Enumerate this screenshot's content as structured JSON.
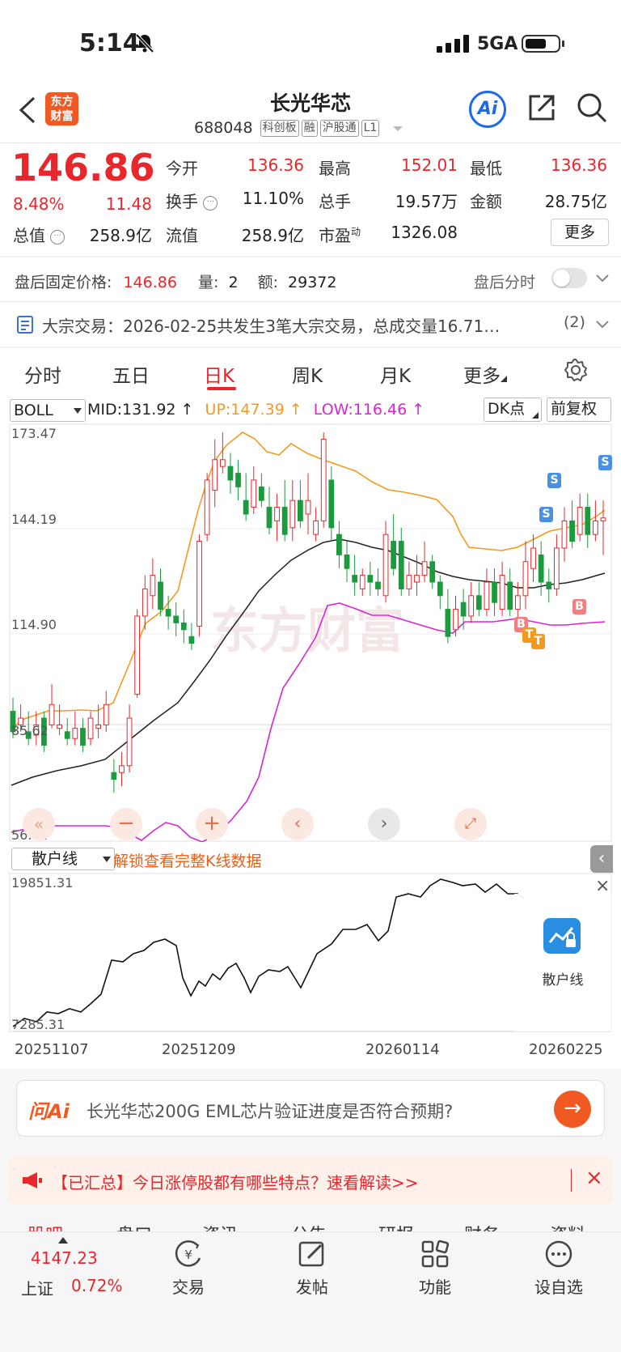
{
  "status_bar": {
    "time": "5:14",
    "network": "5GA"
  },
  "header": {
    "logo_text": "东方\n财富",
    "title": "长光华芯",
    "code": "688048",
    "tags": [
      "科创板",
      "融",
      "沪股通",
      "L1"
    ],
    "ai_label": "Ai"
  },
  "quote": {
    "price": "146.86",
    "change_pct": "8.48%",
    "change": "11.48",
    "open_label": "今开",
    "open": "136.36",
    "high_label": "最高",
    "high": "152.01",
    "low_label": "最低",
    "low": "136.36",
    "turnover_label": "换手",
    "turnover": "11.10%",
    "volume_label": "总手",
    "volume": "19.57万",
    "amount_label": "金额",
    "amount": "28.75亿",
    "mktcap_label": "总值",
    "mktcap": "258.9亿",
    "float_label": "流值",
    "float": "258.9亿",
    "pe_label": "市盈",
    "pe_sup": "动",
    "pe": "1326.08",
    "more_label": "更多"
  },
  "after_hours": {
    "label": "盘后固定价格:",
    "price": "146.86",
    "vol_label": "量:",
    "vol": "2",
    "amt_label": "额:",
    "amt": "29372",
    "toggle_label": "盘后分时"
  },
  "block_trade": {
    "text": "大宗交易：2026-02-25共发生3笔大宗交易，总成交量16.71…",
    "count": "(2)"
  },
  "tabs": [
    "分时",
    "五日",
    "日K",
    "周K",
    "月K",
    "更多"
  ],
  "active_tab": "日K",
  "indicator": {
    "name": "BOLL",
    "mid": "MID:131.92",
    "up": "UP:147.39",
    "low": "LOW:116.46",
    "dk_label": "DK点",
    "adjust_label": "前复权"
  },
  "price_axis": [
    "173.47",
    "144.19",
    "114.90",
    "85.62",
    "56.34"
  ],
  "watermark": "东方财富",
  "sub_chart": {
    "selector": "散户线",
    "unlock_text": "解锁查看完整K线数据",
    "max": "19851.31",
    "min": "7285.31",
    "lock_label": "散户线"
  },
  "dates": [
    "20251107",
    "20251209",
    "20260114",
    "20260225"
  ],
  "ask": {
    "brand": "问Ai",
    "question": "长光华芯200G EML芯片验证进度是否符合预期?"
  },
  "notice": {
    "text": "【已汇总】今日涨停股都有哪些特点？速看解读>>"
  },
  "bottom_tabs_partial": [
    "股吧",
    "盘口",
    "资讯",
    "公告",
    "研报",
    "财务",
    "资料"
  ],
  "index": {
    "value": "4147.23",
    "name": "上证",
    "change": "0.72%"
  },
  "bottom_nav": [
    "交易",
    "发帖",
    "功能",
    "设自选"
  ],
  "colors": {
    "up": "#e8262b",
    "down": "#1a9b3c",
    "boll_up": "#f39a1e",
    "boll_low": "#d925d6",
    "brand": "#f05a22",
    "ai": "#1b6be8"
  },
  "chart_data": {
    "type": "candlestick",
    "y_ticks": [
      173.47,
      144.19,
      114.9,
      85.62,
      56.34
    ],
    "ylim": [
      56.34,
      173.47
    ],
    "boll": {
      "mid": 131.92,
      "up": 147.39,
      "low": 116.46
    },
    "last_close": 146.86
  }
}
